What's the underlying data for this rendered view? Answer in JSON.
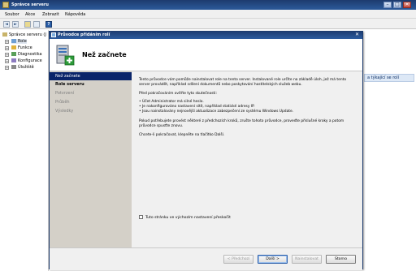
{
  "window": {
    "title": "Správce serveru",
    "controls": {
      "minimize": "–",
      "maximize": "□",
      "close": "✕"
    }
  },
  "menu": [
    "Soubor",
    "Akce",
    "Zobrazit",
    "Nápověda"
  ],
  "toolbar": {
    "back": "◄",
    "forward": "►",
    "help": "?"
  },
  "tree": {
    "root": "Správce serveru (J",
    "items": [
      "Role",
      "Funkce",
      "Diagnostika",
      "Konfigurace",
      "Úložiště"
    ],
    "expander": "+"
  },
  "right_pane": {
    "link": "a týkající se rolí"
  },
  "dialog": {
    "title": "Průvodce přidáním rolí",
    "close": "✕",
    "heading": "Než začnete",
    "nav": [
      {
        "label": "Než začnete",
        "state": "active"
      },
      {
        "label": "Role serveru",
        "state": "normal"
      },
      {
        "label": "Potvrzení",
        "state": "dim"
      },
      {
        "label": "Průběh",
        "state": "dim"
      },
      {
        "label": "Výsledky",
        "state": "dim"
      }
    ],
    "content": {
      "intro": "Tento průvodce vám pomůže nainstalovat role na tento server. Instalované role určíte na základě úloh, jež má tento server provádět, například sdílení dokumentů nebo poskytování hostitelských služeb webu.",
      "verify_heading": "Před pokračováním ověřte tyto skutečnosti:",
      "bullets": [
        "• Účet Administrator má silné heslo.",
        "• Je nakonfigurováno nastavení sítě, například statické adresy IP.",
        "• Jsou nainstalovány nejnovější aktualizace zabezpečení ze systému Windows Update."
      ],
      "note": "Pokud potřebujete provést některé z předchozích kroků, zrušte tohoto průvodce, proveďte příslušné kroky a potom průvodce spusťte znovu.",
      "continue": "Chcete-li pokračovat, klepněte na tlačítko Další.",
      "skip_checkbox": "Tuto stránku ve výchozím nastavení přeskočit"
    },
    "buttons": {
      "previous": "< Předchozí",
      "next": "Další >",
      "install": "Nainstalovat",
      "cancel": "Storno"
    }
  }
}
